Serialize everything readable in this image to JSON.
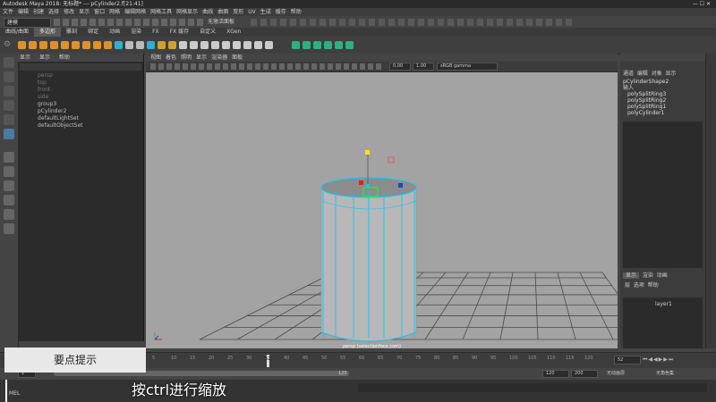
{
  "window": {
    "title": "Autodesk Maya 2018: 无标题* --- pCylinder2.f[21:41]"
  },
  "menubar": {
    "items": [
      "文件",
      "编辑",
      "创建",
      "选择",
      "修改",
      "显示",
      "窗口",
      "网格",
      "编辑网格",
      "网格工具",
      "网格显示",
      "曲线",
      "曲面",
      "变形",
      "UV",
      "生成",
      "缓存",
      "帮助"
    ]
  },
  "statusline": {
    "mode": "建模",
    "symmetry": "无激活面板"
  },
  "shelf": {
    "tabs": [
      "曲线/曲面",
      "多边形",
      "雕刻",
      "绑定",
      "动画",
      "渲染",
      "FX",
      "FX 缓存",
      "自定义",
      "XGen"
    ],
    "active": "多边形"
  },
  "outliner": {
    "menu": [
      "显示",
      "显示",
      "帮助"
    ],
    "items": [
      {
        "label": "persp",
        "dim": true
      },
      {
        "label": "top",
        "dim": true
      },
      {
        "label": "front",
        "dim": true
      },
      {
        "label": "side",
        "dim": true
      },
      {
        "label": "group3",
        "dim": false
      },
      {
        "label": "pCylinder2",
        "dim": false
      },
      {
        "label": "defaultLightSet",
        "dim": false
      },
      {
        "label": "defaultObjectSet",
        "dim": false
      }
    ]
  },
  "viewport": {
    "menu": [
      "视图",
      "着色",
      "照明",
      "显示",
      "渲染器",
      "面板"
    ],
    "gamma_a": "0.00",
    "gamma_b": "1.00",
    "colorspace": "sRGB gamma",
    "camera_label": "persp (selectionface.com)"
  },
  "channelbox": {
    "tabs": [
      "通道",
      "编辑",
      "对象",
      "显示"
    ],
    "shape": "pCylinderShape2",
    "inputs_label": "输入",
    "inputs": [
      "polySplitRing3",
      "polySplitRing2",
      "polySplitRing1",
      "polyCylinder1"
    ]
  },
  "layers": {
    "tabs": [
      "显示",
      "渲染",
      "动画"
    ],
    "menu": [
      "层",
      "选项",
      "帮助"
    ],
    "layer1": "layer1"
  },
  "timeline": {
    "ticks": [
      "5",
      "10",
      "15",
      "20",
      "25",
      "30",
      "35",
      "40",
      "45",
      "50",
      "55",
      "60",
      "65",
      "70",
      "75",
      "80",
      "85",
      "90",
      "95",
      "100",
      "105",
      "110",
      "115",
      "120"
    ],
    "current_frame": "52",
    "frame_field": "52"
  },
  "rangebar": {
    "start": "1",
    "end": "120",
    "end2": "120",
    "max": "200",
    "anim_layer": "无动画层",
    "char_set": "无角色集"
  },
  "cmdline": {
    "label": "MEL"
  },
  "overlay": {
    "tip_title": "要点提示",
    "subtitle": "按ctrl进行缩放"
  },
  "colors": {
    "selection": "#00d0ff",
    "handle_y": "#ffe600",
    "handle_x": "#e02020",
    "handle_z": "#2040e0"
  }
}
